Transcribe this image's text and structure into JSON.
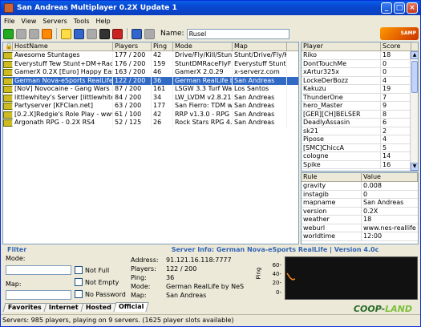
{
  "window": {
    "title": "San Andreas Multiplayer 0.2X Update 1"
  },
  "menu": [
    "File",
    "View",
    "Servers",
    "Tools",
    "Help"
  ],
  "toolbar": {
    "name_label": "Name:",
    "name_value": "Rusel",
    "logo_text": "SAMP"
  },
  "servers": {
    "columns": [
      "",
      "HostName",
      "Players",
      "Ping",
      "Mode",
      "Map"
    ],
    "rows": [
      {
        "host": "Awesome Stuntages",
        "players": "177 / 200",
        "ping": "42",
        "mode": "Drive/Fly/Kill/Stun",
        "map": "Stunt/Drive/Fly/K"
      },
      {
        "host": "Everystuff Tew Stunt+DM+Race",
        "players": "176 / 200",
        "ping": "159",
        "mode": "StuntDMRaceFlyFR",
        "map": "Everystuff Stunt"
      },
      {
        "host": "GamerX 0.2X [Euro] Happy Easter!",
        "players": "163 / 200",
        "ping": "46",
        "mode": "GamerX 2.0.29",
        "map": "x-serverz.com"
      },
      {
        "host": "German Nova-eSports RealLife | Versio",
        "players": "122 / 200",
        "ping": "36",
        "mode": "German RealLife b",
        "map": "San Andreas",
        "selected": true
      },
      {
        "host": "[NoV] Novocaine - Gang Wars [novclan",
        "players": "87 / 200",
        "ping": "161",
        "mode": "LSGW 3.3 Turf Wa",
        "map": "Los Santos"
      },
      {
        "host": "littlewhitey's Server [littlewhiteys.co.uk",
        "players": "84 / 200",
        "ping": "34",
        "mode": "LW_LVDM v2.8.21",
        "map": "San Andreas"
      },
      {
        "host": "Partyserver [KFClan.net]",
        "players": "63 / 200",
        "ping": "177",
        "mode": "San Fierro: TDM w",
        "map": "San Andreas"
      },
      {
        "host": "[0.2.X]Redgie's Role Play - www.Redgie",
        "players": "61 / 100",
        "ping": "42",
        "mode": "RRP v1.3.0 - RPG",
        "map": "San Andreas"
      },
      {
        "host": "Argonath RPG - 0.2X RS4",
        "players": "52 / 125",
        "ping": "26",
        "mode": "Rock Stars RPG 4.",
        "map": "San Andreas"
      }
    ]
  },
  "players": {
    "columns": [
      "Player",
      "Score"
    ],
    "rows": [
      {
        "name": "Riko",
        "score": "18"
      },
      {
        "name": "DontTouchMe",
        "score": "0"
      },
      {
        "name": "xArtur325x",
        "score": "0"
      },
      {
        "name": "LockeDerBozz",
        "score": "4"
      },
      {
        "name": "Kakuzu",
        "score": "19"
      },
      {
        "name": "ThunderOne",
        "score": "7"
      },
      {
        "name": "hero_Master",
        "score": "9"
      },
      {
        "name": "[GER][CH]BELSER",
        "score": "8"
      },
      {
        "name": "DeadlyAssasin",
        "score": "6"
      },
      {
        "name": "sk21",
        "score": "2"
      },
      {
        "name": "Pipose",
        "score": "4"
      },
      {
        "name": "[SMC]ChiccA",
        "score": "5"
      },
      {
        "name": "cologne",
        "score": "14"
      },
      {
        "name": "Spike",
        "score": "16"
      }
    ]
  },
  "rules": {
    "columns": [
      "Rule",
      "Value"
    ],
    "rows": [
      {
        "rule": "gravity",
        "value": "0.008"
      },
      {
        "rule": "instagib",
        "value": "0"
      },
      {
        "rule": "mapname",
        "value": "San Andreas"
      },
      {
        "rule": "version",
        "value": "0.2X"
      },
      {
        "rule": "weather",
        "value": "18"
      },
      {
        "rule": "weburl",
        "value": "www.nes-reallife"
      },
      {
        "rule": "worldtime",
        "value": "12:00"
      }
    ]
  },
  "filter": {
    "title": "Filter",
    "mode_label": "Mode:",
    "map_label": "Map:",
    "not_full": "Not Full",
    "not_empty": "Not Empty",
    "no_password": "No Password"
  },
  "server_info": {
    "title": "Server Info: German Nova-eSports RealLife | Version 4.0c",
    "address_label": "Address:",
    "address": "91.121.16.118:7777",
    "players_label": "Players:",
    "players": "122 / 200",
    "ping_label": "Ping:",
    "ping": "36",
    "mode_label": "Mode:",
    "mode": "German RealLife by NeS",
    "map_label": "Map:",
    "map": "San Andreas",
    "graph_axis": "Ping",
    "graph_ticks": [
      "60-",
      "40-",
      "20-",
      "0-"
    ]
  },
  "tabs": [
    "Favorites",
    "Internet",
    "Hosted",
    "Official"
  ],
  "logo_bottom": {
    "a": "COOP-",
    "b": "LAND"
  },
  "status": "Servers: 985 players, playing on 9 servers. (1625 player slots available)"
}
